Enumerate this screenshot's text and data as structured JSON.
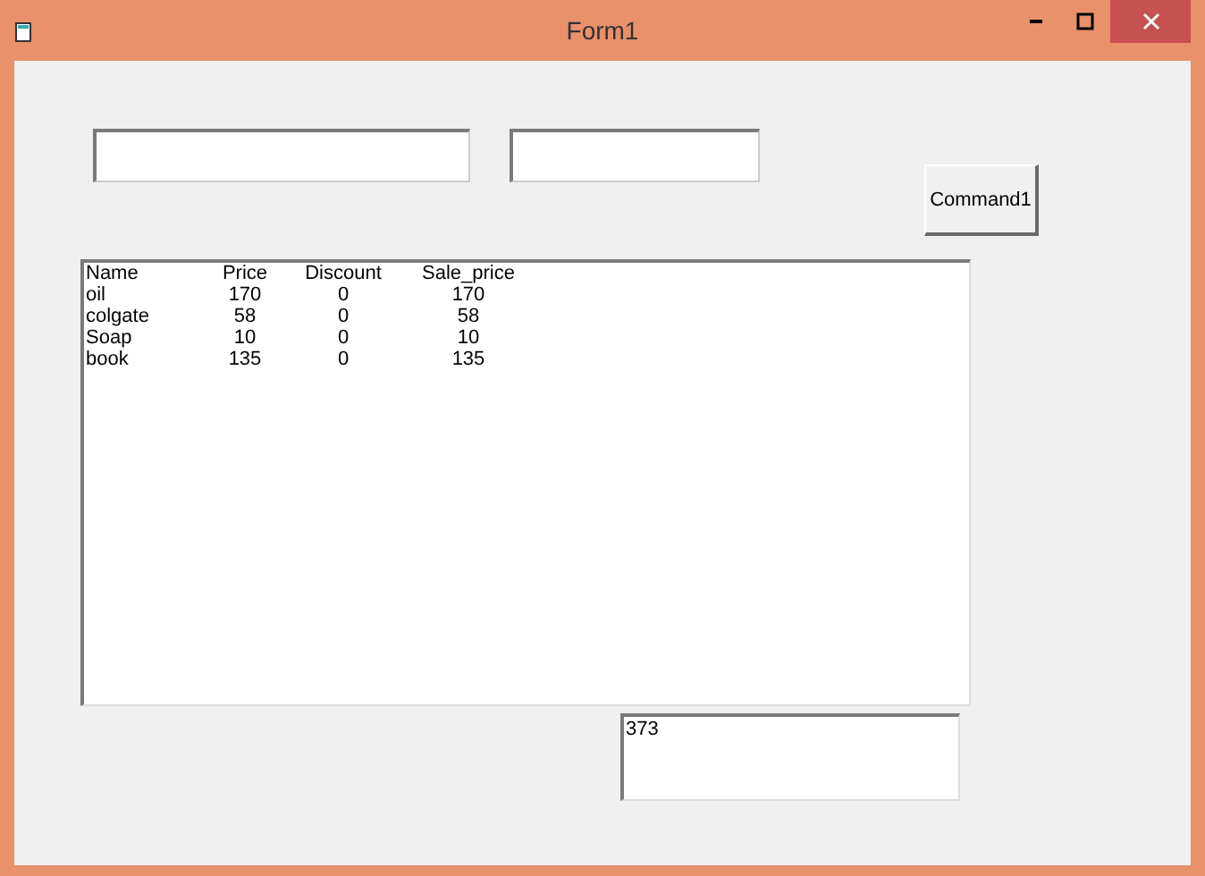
{
  "window": {
    "title": "Form1"
  },
  "button": {
    "label": "Command1"
  },
  "list": {
    "rows": [
      [
        "Name",
        "Price",
        "Discount",
        "Sale_price"
      ],
      [
        "oil",
        "170",
        "0",
        "170"
      ],
      [
        "colgate",
        "58",
        "0",
        "58"
      ],
      [
        "Soap",
        "10",
        "0",
        "10"
      ],
      [
        "book",
        "135",
        "0",
        "135"
      ]
    ]
  },
  "total_field": {
    "value": "373"
  }
}
